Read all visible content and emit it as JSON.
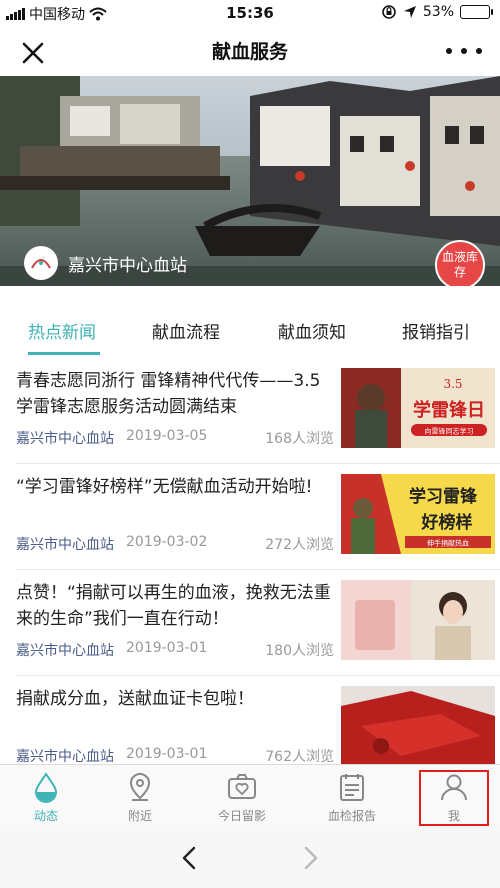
{
  "status_bar": {
    "carrier": "中国移动",
    "time": "15:36",
    "battery": "53%",
    "battery_level": 0.53,
    "icons": [
      "signal-icon",
      "wifi-icon",
      "orientation-lock-icon",
      "location-icon",
      "battery-icon"
    ]
  },
  "nav": {
    "title": "献血服务",
    "close_icon": "close-icon",
    "more_icon": "more-icon"
  },
  "banner": {
    "station_name": "嘉兴市中心血站",
    "stock_button": "血液库存"
  },
  "tabs": [
    {
      "label": "热点新闻",
      "active": true
    },
    {
      "label": "献血流程",
      "active": false
    },
    {
      "label": "献血须知",
      "active": false
    },
    {
      "label": "报销指引",
      "active": false
    }
  ],
  "news": [
    {
      "title": "青春志愿同浙行 雷锋精神代代传——3.5学雷锋志愿服务活动圆满结束",
      "source": "嘉兴市中心血站",
      "date": "2019-03-05",
      "views": "168人浏览",
      "thumb_text": "学雷锋日",
      "thumb_sub": "3.5",
      "thumb_caption": "向雷锋同志学习"
    },
    {
      "title": "“学习雷锋好榜样”无偿献血活动开始啦!",
      "source": "嘉兴市中心血站",
      "date": "2019-03-02",
      "views": "272人浏览",
      "thumb_text": "学习雷锋",
      "thumb_sub": "好榜样",
      "thumb_caption": "伸手捐献热血"
    },
    {
      "title": "点赞！“捐献可以再生的血液，挽救无法重来的生命”我们一直在行动！",
      "source": "嘉兴市中心血站",
      "date": "2019-03-01",
      "views": "180人浏览"
    },
    {
      "title": "捐献成分血，送献血证卡包啦！",
      "source": "嘉兴市中心血站",
      "date": "2019-03-01",
      "views": "762人浏览"
    }
  ],
  "tabbar": [
    {
      "label": "动态",
      "icon": "droplet-icon",
      "active": true
    },
    {
      "label": "附近",
      "icon": "location-pin-icon",
      "active": false
    },
    {
      "label": "今日留影",
      "icon": "camera-heart-icon",
      "active": false
    },
    {
      "label": "血检报告",
      "icon": "report-icon",
      "active": false
    },
    {
      "label": "我",
      "icon": "person-icon",
      "active": false
    }
  ],
  "colors": {
    "accent": "#3fb3b5",
    "source_text": "#4a5c89",
    "stock_button": "#e64646",
    "highlight_box": "#e02020"
  }
}
